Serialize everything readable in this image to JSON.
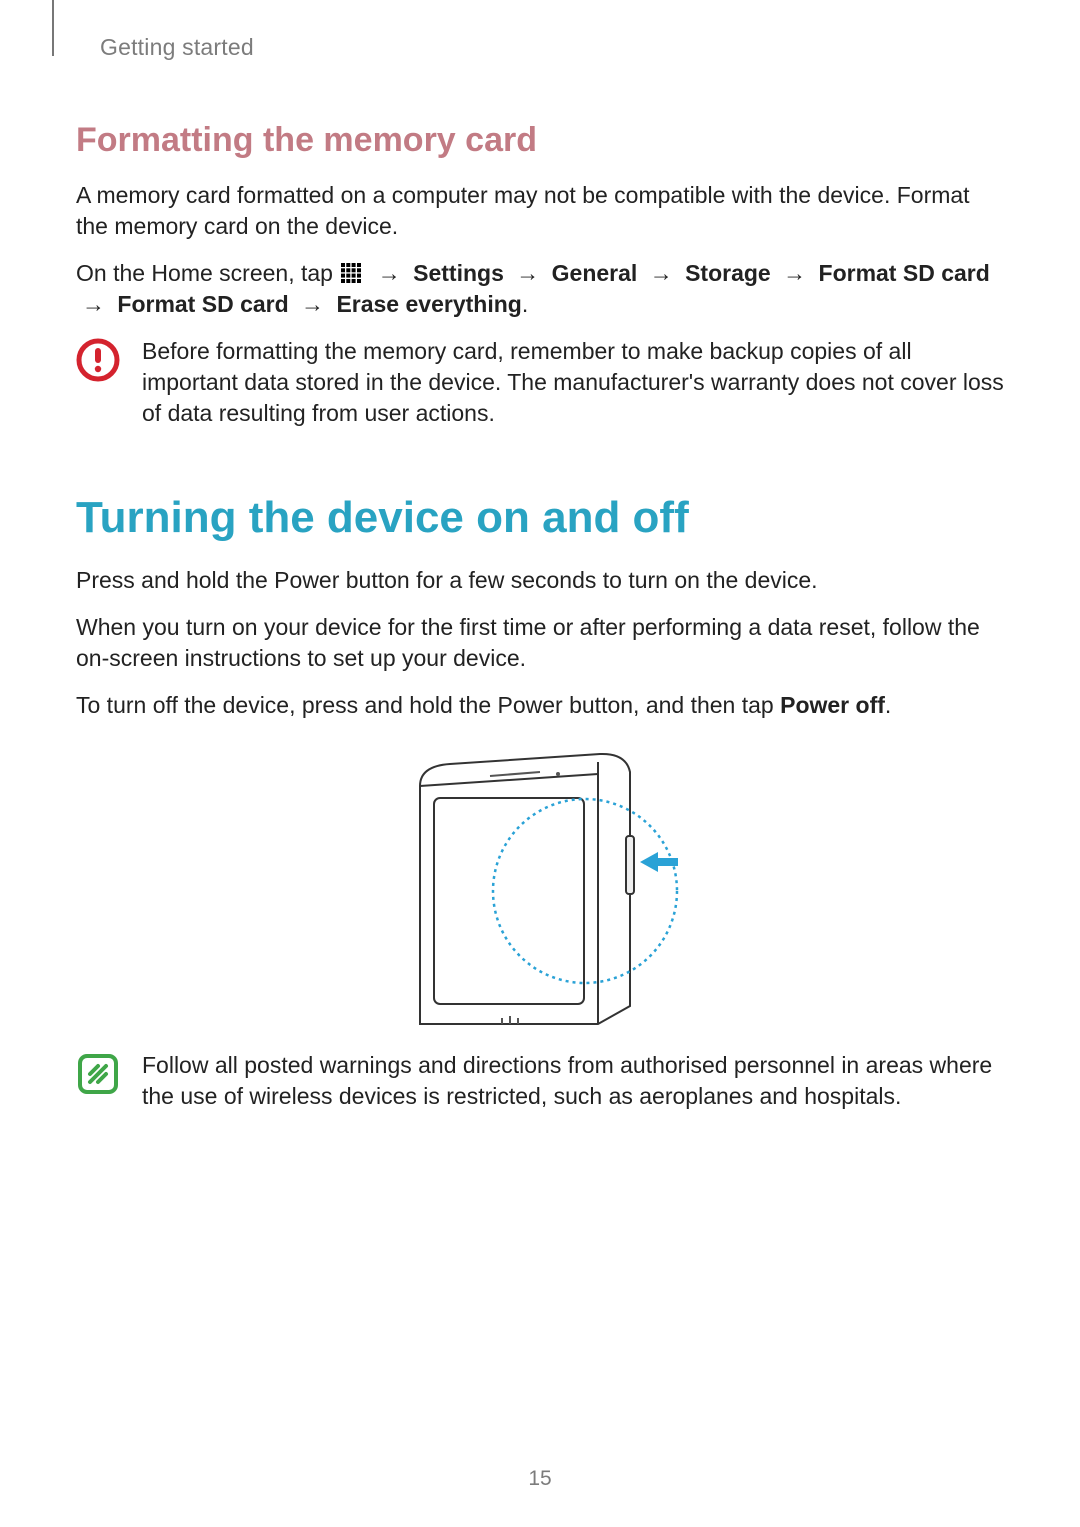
{
  "chapter": "Getting started",
  "section1": {
    "heading": "Formatting the memory card",
    "para1": "A memory card formatted on a computer may not be compatible with the device. Format the memory card on the device.",
    "instr_prefix": "On the Home screen, tap ",
    "path": {
      "settings": "Settings",
      "general": "General",
      "storage": "Storage",
      "format1": "Format SD card",
      "format2": "Format SD card",
      "erase": "Erase everything"
    },
    "warning": "Before formatting the memory card, remember to make backup copies of all important data stored in the device. The manufacturer's warranty does not cover loss of data resulting from user actions."
  },
  "section2": {
    "heading": "Turning the device on and off",
    "para1": "Press and hold the Power button for a few seconds to turn on the device.",
    "para2": "When you turn on your device for the first time or after performing a data reset, follow the on-screen instructions to set up your device.",
    "para3_prefix": "To turn off the device, press and hold the Power button, and then tap ",
    "para3_bold": "Power off",
    "para3_suffix": ".",
    "note": "Follow all posted warnings and directions from authorised personnel in areas where the use of wireless devices is restricted, such as aeroplanes and hospitals."
  },
  "arrow_glyph": "→",
  "page_number": "15"
}
